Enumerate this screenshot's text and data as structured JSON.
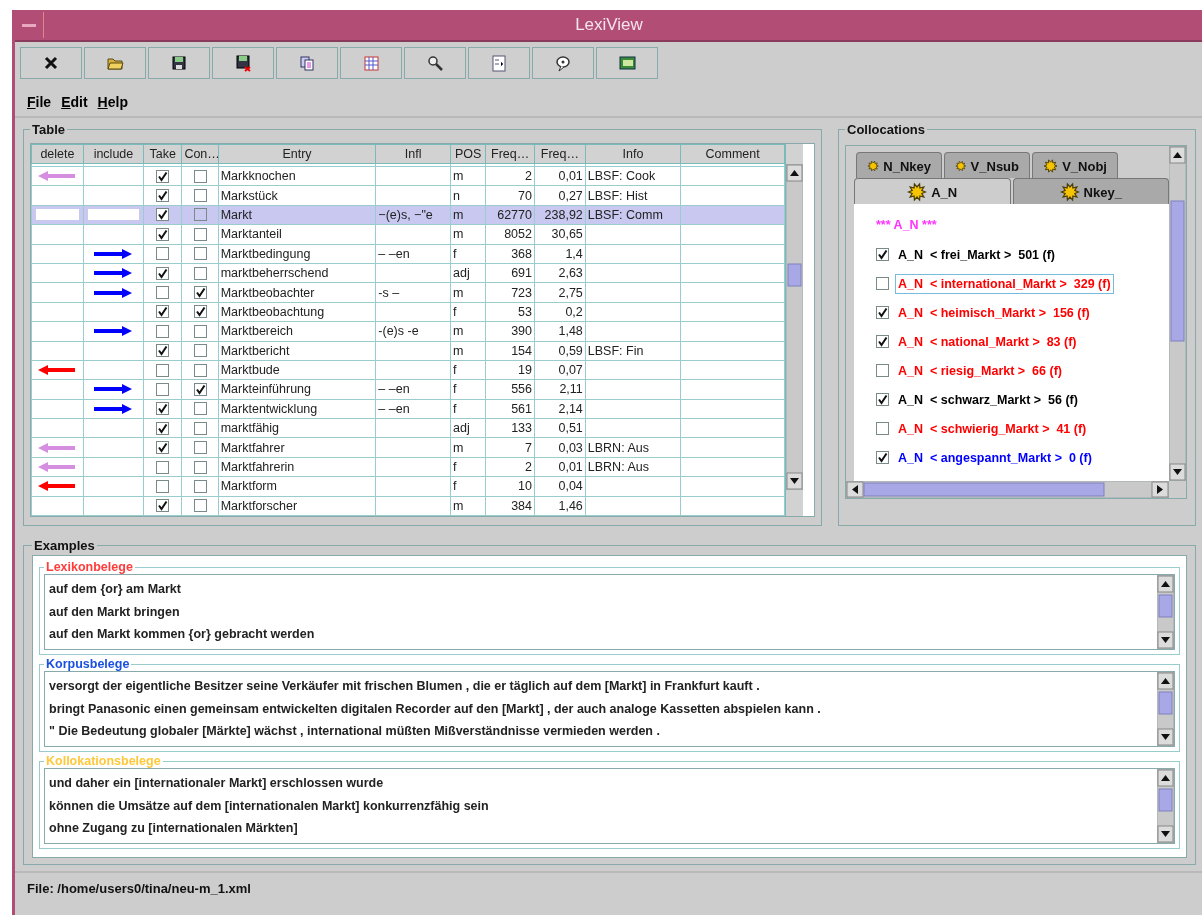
{
  "window": {
    "title": "LexiView"
  },
  "toolbar": [
    {
      "kind": "close"
    },
    {
      "kind": "open"
    },
    {
      "kind": "save"
    },
    {
      "kind": "save-as"
    },
    {
      "kind": "copy"
    },
    {
      "kind": "table"
    },
    {
      "kind": "search"
    },
    {
      "kind": "document"
    },
    {
      "kind": "comment"
    },
    {
      "kind": "notes"
    }
  ],
  "menu": [
    {
      "label": "File"
    },
    {
      "label": "Edit"
    },
    {
      "label": "Help"
    }
  ],
  "table": {
    "title": "Table",
    "columns": [
      "delete",
      "include",
      "Take",
      "Con…",
      "Entry",
      "Infl",
      "POS",
      "Freq…",
      "Freq…",
      "Info",
      "Comment"
    ],
    "rows": [
      {
        "delete_arrow": true,
        "arrow": {
          "color": "#d58ee0"
        },
        "include_arrow": false,
        "take": true,
        "con": false,
        "entry": "Markknochen",
        "infl": "",
        "pos": "m",
        "freq": "2",
        "freq_rel": "0,01",
        "info": "LBSF: Cook",
        "selected": false
      },
      {
        "delete_arrow": false,
        "include_arrow": false,
        "take": true,
        "con": false,
        "entry": "Markstück",
        "infl": "",
        "pos": "n",
        "freq": "70",
        "freq_rel": "0,27",
        "info": "LBSF: Hist",
        "selected": false
      },
      {
        "delete_arrow": false,
        "include_arrow": false,
        "take": true,
        "con": false,
        "entry": "Markt",
        "infl": "−(e)s, −\"e",
        "pos": "m",
        "freq": "62770",
        "freq_rel": "238,92",
        "info": "LBSF: Comm",
        "selected": true
      },
      {
        "delete_arrow": false,
        "include_arrow": false,
        "take": true,
        "con": false,
        "entry": "Marktanteil",
        "infl": "",
        "pos": "m",
        "freq": "8052",
        "freq_rel": "30,65",
        "info": "",
        "selected": false
      },
      {
        "delete_arrow": false,
        "include_arrow": true,
        "take": false,
        "con": false,
        "entry": "Marktbedingung",
        "infl": "– –en",
        "pos": "f",
        "freq": "368",
        "freq_rel": "1,4",
        "info": "",
        "selected": false
      },
      {
        "delete_arrow": false,
        "include_arrow": true,
        "take": true,
        "con": false,
        "entry": "marktbeherrschend",
        "infl": "",
        "pos": "adj",
        "freq": "691",
        "freq_rel": "2,63",
        "info": "",
        "selected": false
      },
      {
        "delete_arrow": false,
        "include_arrow": true,
        "take": false,
        "con": true,
        "entry": "Marktbeobachter",
        "infl": "-s –",
        "pos": "m",
        "freq": "723",
        "freq_rel": "2,75",
        "info": "",
        "selected": false
      },
      {
        "delete_arrow": false,
        "include_arrow": false,
        "take": true,
        "con": true,
        "entry": "Marktbeobachtung",
        "infl": "",
        "pos": "f",
        "freq": "53",
        "freq_rel": "0,2",
        "info": "",
        "selected": false
      },
      {
        "delete_arrow": false,
        "include_arrow": true,
        "take": false,
        "con": false,
        "entry": "Marktbereich",
        "infl": "-(e)s -e",
        "pos": "m",
        "freq": "390",
        "freq_rel": "1,48",
        "info": "",
        "selected": false
      },
      {
        "delete_arrow": false,
        "include_arrow": false,
        "take": true,
        "con": false,
        "entry": "Marktbericht",
        "infl": "",
        "pos": "m",
        "freq": "154",
        "freq_rel": "0,59",
        "info": "LBSF: Fin",
        "selected": false
      },
      {
        "delete_arrow": true,
        "arrow": {
          "color": "#ff0000"
        },
        "include_arrow": false,
        "take": false,
        "con": false,
        "entry": "Marktbude",
        "infl": "",
        "pos": "f",
        "freq": "19",
        "freq_rel": "0,07",
        "info": "",
        "selected": false
      },
      {
        "delete_arrow": false,
        "include_arrow": true,
        "take": false,
        "con": true,
        "entry": "Markteinführung",
        "infl": "– –en",
        "pos": "f",
        "freq": "556",
        "freq_rel": "2,11",
        "info": "",
        "selected": false
      },
      {
        "delete_arrow": false,
        "include_arrow": true,
        "take": true,
        "con": false,
        "entry": "Marktentwicklung",
        "infl": "– –en",
        "pos": "f",
        "freq": "561",
        "freq_rel": "2,14",
        "info": "",
        "selected": false
      },
      {
        "delete_arrow": false,
        "include_arrow": false,
        "take": true,
        "con": false,
        "entry": "marktfähig",
        "infl": "",
        "pos": "adj",
        "freq": "133",
        "freq_rel": "0,51",
        "info": "",
        "selected": false
      },
      {
        "delete_arrow": true,
        "arrow": {
          "color": "#d58ee0"
        },
        "include_arrow": false,
        "take": true,
        "con": false,
        "entry": "Marktfahrer",
        "infl": "",
        "pos": "m",
        "freq": "7",
        "freq_rel": "0,03",
        "info": "LBRN: Aus",
        "selected": false
      },
      {
        "delete_arrow": true,
        "arrow": {
          "color": "#d58ee0"
        },
        "include_arrow": false,
        "take": false,
        "con": false,
        "entry": "Marktfahrerin",
        "infl": "",
        "pos": "f",
        "freq": "2",
        "freq_rel": "0,01",
        "info": "LBRN: Aus",
        "selected": false
      },
      {
        "delete_arrow": true,
        "arrow": {
          "color": "#ff0000"
        },
        "include_arrow": false,
        "take": false,
        "con": false,
        "entry": "Marktform",
        "infl": "",
        "pos": "f",
        "freq": "10",
        "freq_rel": "0,04",
        "info": "",
        "selected": false
      },
      {
        "delete_arrow": false,
        "include_arrow": false,
        "take": true,
        "con": false,
        "entry": "Marktforscher",
        "infl": "",
        "pos": "m",
        "freq": "384",
        "freq_rel": "1,46",
        "info": "",
        "selected": false
      }
    ]
  },
  "collocations": {
    "title": "Collocations",
    "tab_rows": [
      [
        {
          "label": "N_Nkey",
          "selected": false
        },
        {
          "label": "V_Nsub",
          "selected": false
        },
        {
          "label": "V_Nobj",
          "selected": false
        }
      ],
      [
        {
          "label": "A_N",
          "selected": true
        },
        {
          "label": "Nkey_",
          "selected": false
        }
      ]
    ],
    "heading": "*** A_N ***",
    "items": [
      {
        "checked": true,
        "focused": false,
        "color": "#000000",
        "label": "A_N  < frei_Markt >  501 (f)"
      },
      {
        "checked": false,
        "focused": true,
        "color": "#ff0000",
        "label": "A_N  < international_Markt >  329 (f)"
      },
      {
        "checked": true,
        "focused": false,
        "color": "#ff0000",
        "label": "A_N  < heimisch_Markt >  156 (f)"
      },
      {
        "checked": true,
        "focused": false,
        "color": "#ff0000",
        "label": "A_N  < national_Markt >  83 (f)"
      },
      {
        "checked": false,
        "focused": false,
        "color": "#ff0000",
        "label": "A_N  < riesig_Markt >  66 (f)"
      },
      {
        "checked": true,
        "focused": false,
        "color": "#000000",
        "label": "A_N  < schwarz_Markt >  56 (f)"
      },
      {
        "checked": false,
        "focused": false,
        "color": "#ff0000",
        "label": "A_N  < schwierig_Markt >  41 (f)"
      },
      {
        "checked": true,
        "focused": false,
        "color": "#0000ff",
        "label": "A_N  < angespannt_Markt >  0 (f)"
      }
    ]
  },
  "examples": {
    "title": "Examples",
    "sections": [
      {
        "title": "Lexikonbelege",
        "color": "#ff3b3b",
        "lines": [
          "auf dem {or} am Markt",
          "auf den Markt bringen",
          "auf den Markt kommen {or} gebracht werden"
        ]
      },
      {
        "title": "Korpusbelege",
        "color": "#1a4fe0",
        "lines": [
          "versorgt der eigentliche Besitzer seine Verkäufer mit frischen Blumen , die er täglich auf dem [Markt] in Frankfurt kauft .",
          "bringt Panasonic einen gemeinsam entwickelten digitalen Recorder auf den [Markt] , der auch analoge Kassetten abspielen kann .",
          "\" Die Bedeutung globaler [Märkte] wächst , international müßten Mißverständnisse vermieden werden ."
        ]
      },
      {
        "title": "Kollokationsbelege",
        "color": "#ffc83a",
        "lines": [
          "und daher ein [internationaler Markt] erschlossen wurde",
          "können die Umsätze auf dem [internationalen Markt] konkurrenzfähig sein",
          "ohne Zugang zu [internationalen Märkten]"
        ]
      }
    ]
  },
  "status_bar": "File: /home/users0/tina/neu-m_1.xml"
}
